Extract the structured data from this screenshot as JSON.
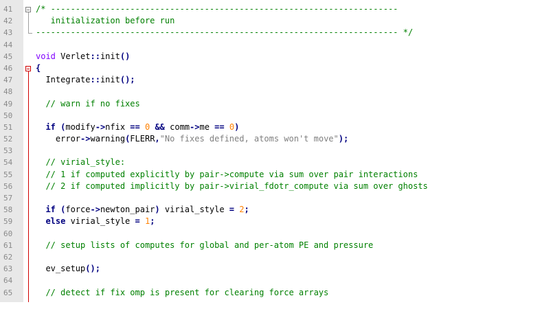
{
  "editor": {
    "lines": [
      {
        "n": "41",
        "segs": [
          {
            "t": "/* ----------------------------------------------------------------------",
            "c": "cmt"
          }
        ]
      },
      {
        "n": "42",
        "segs": [
          {
            "t": "   initialization before run",
            "c": "cmt"
          }
        ]
      },
      {
        "n": "43",
        "segs": [
          {
            "t": "------------------------------------------------------------------------- */",
            "c": "cmt"
          }
        ]
      },
      {
        "n": "44",
        "segs": []
      },
      {
        "n": "45",
        "segs": [
          {
            "t": "void ",
            "c": "type"
          },
          {
            "t": "Verlet",
            "c": "fn"
          },
          {
            "t": "::",
            "c": "op"
          },
          {
            "t": "init",
            "c": "fn"
          },
          {
            "t": "()",
            "c": "op"
          }
        ]
      },
      {
        "n": "46",
        "segs": [
          {
            "t": "{",
            "c": "op"
          }
        ]
      },
      {
        "n": "47",
        "segs": [
          {
            "t": "  Integrate",
            "c": "fn"
          },
          {
            "t": "::",
            "c": "op"
          },
          {
            "t": "init",
            "c": "fn"
          },
          {
            "t": "();",
            "c": "op"
          }
        ]
      },
      {
        "n": "48",
        "segs": []
      },
      {
        "n": "49",
        "segs": [
          {
            "t": "  // warn if no fixes",
            "c": "cmt"
          }
        ]
      },
      {
        "n": "50",
        "segs": []
      },
      {
        "n": "51",
        "segs": [
          {
            "t": "  if ",
            "c": "kw"
          },
          {
            "t": "(",
            "c": "op"
          },
          {
            "t": "modify",
            "c": "fn"
          },
          {
            "t": "->",
            "c": "op"
          },
          {
            "t": "nfix ",
            "c": "fn"
          },
          {
            "t": "== ",
            "c": "op"
          },
          {
            "t": "0 ",
            "c": "num"
          },
          {
            "t": "&& ",
            "c": "op"
          },
          {
            "t": "comm",
            "c": "fn"
          },
          {
            "t": "->",
            "c": "op"
          },
          {
            "t": "me ",
            "c": "fn"
          },
          {
            "t": "== ",
            "c": "op"
          },
          {
            "t": "0",
            "c": "num"
          },
          {
            "t": ")",
            "c": "op"
          }
        ]
      },
      {
        "n": "52",
        "segs": [
          {
            "t": "    error",
            "c": "fn"
          },
          {
            "t": "->",
            "c": "op"
          },
          {
            "t": "warning",
            "c": "fn"
          },
          {
            "t": "(",
            "c": "op"
          },
          {
            "t": "FLERR",
            "c": "fn"
          },
          {
            "t": ",",
            "c": "op"
          },
          {
            "t": "\"No fixes defined, atoms won't move\"",
            "c": "str"
          },
          {
            "t": ");",
            "c": "op"
          }
        ]
      },
      {
        "n": "53",
        "segs": []
      },
      {
        "n": "54",
        "segs": [
          {
            "t": "  // virial_style:",
            "c": "cmt"
          }
        ]
      },
      {
        "n": "55",
        "segs": [
          {
            "t": "  // 1 if computed explicitly by pair->compute via sum over pair interactions",
            "c": "cmt"
          }
        ]
      },
      {
        "n": "56",
        "segs": [
          {
            "t": "  // 2 if computed implicitly by pair->virial_fdotr_compute via sum over ghosts",
            "c": "cmt"
          }
        ]
      },
      {
        "n": "57",
        "segs": []
      },
      {
        "n": "58",
        "segs": [
          {
            "t": "  if ",
            "c": "kw"
          },
          {
            "t": "(",
            "c": "op"
          },
          {
            "t": "force",
            "c": "fn"
          },
          {
            "t": "->",
            "c": "op"
          },
          {
            "t": "newton_pair",
            "c": "fn"
          },
          {
            "t": ") ",
            "c": "op"
          },
          {
            "t": "virial_style ",
            "c": "fn"
          },
          {
            "t": "= ",
            "c": "op"
          },
          {
            "t": "2",
            "c": "num"
          },
          {
            "t": ";",
            "c": "op"
          }
        ]
      },
      {
        "n": "59",
        "segs": [
          {
            "t": "  else ",
            "c": "kw"
          },
          {
            "t": "virial_style ",
            "c": "fn"
          },
          {
            "t": "= ",
            "c": "op"
          },
          {
            "t": "1",
            "c": "num"
          },
          {
            "t": ";",
            "c": "op"
          }
        ]
      },
      {
        "n": "60",
        "segs": []
      },
      {
        "n": "61",
        "segs": [
          {
            "t": "  // setup lists of computes for global and per-atom PE and pressure",
            "c": "cmt"
          }
        ]
      },
      {
        "n": "62",
        "segs": []
      },
      {
        "n": "63",
        "segs": [
          {
            "t": "  ev_setup",
            "c": "fn"
          },
          {
            "t": "();",
            "c": "op"
          }
        ]
      },
      {
        "n": "64",
        "segs": []
      },
      {
        "n": "65",
        "segs": [
          {
            "t": "  // detect if fix omp is present for clearing force arrays",
            "c": "cmt"
          }
        ]
      }
    ]
  }
}
